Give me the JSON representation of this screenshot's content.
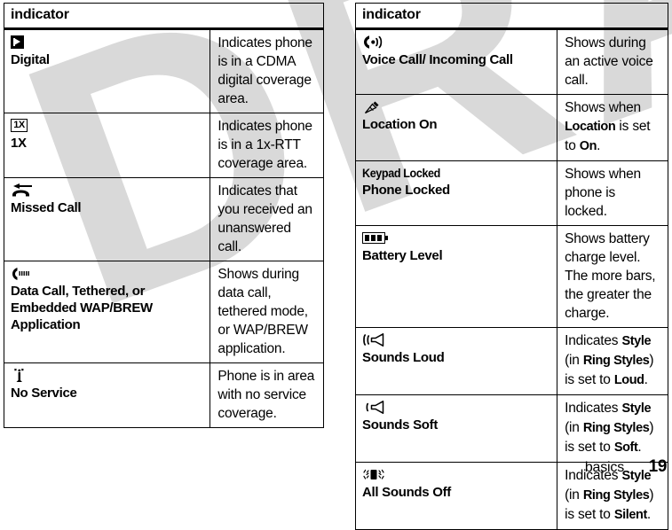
{
  "document": {
    "watermark": "DRAFT",
    "footer": {
      "section": "basics",
      "page_number": "19"
    }
  },
  "tables": {
    "left": {
      "header": "indicator",
      "rows": [
        {
          "icon": "digital-square-icon",
          "name": "Digital",
          "description": "Indicates phone is in a CDMA digital coverage area."
        },
        {
          "icon": "1x-box-icon",
          "icon_text": "1X",
          "name": "1X",
          "description": "Indicates phone is in a 1x-RTT coverage area."
        },
        {
          "icon": "missed-call-icon",
          "name": "Missed Call",
          "description": "Indicates that you received an unanswered call."
        },
        {
          "icon": "data-call-icon",
          "name": "Data Call, Tethered, or Embedded WAP/BREW Application",
          "description": "Shows during data call, tethered mode, or WAP/BREW application."
        },
        {
          "icon": "no-service-antenna-icon",
          "name": "No Service",
          "description": "Phone is in area with no service coverage."
        }
      ]
    },
    "right": {
      "header": "indicator",
      "rows": [
        {
          "icon": "voice-call-icon",
          "name": "Voice Call/ Incoming Call",
          "description": "Shows during an active voice call."
        },
        {
          "icon": "location-on-icon",
          "name": "Location On",
          "description_parts": [
            {
              "text": "Shows when ",
              "bold": false
            },
            {
              "text": "Location",
              "bold": true
            },
            {
              "text": " is set to ",
              "bold": false
            },
            {
              "text": "On",
              "bold": true
            },
            {
              "text": ".",
              "bold": false
            }
          ]
        },
        {
          "icon": "keypad-locked-text-icon",
          "icon_text": "Keypad Locked",
          "name": "Phone Locked",
          "description": "Shows when phone is locked."
        },
        {
          "icon": "battery-level-icon",
          "name": "Battery Level",
          "description": "Shows battery charge level. The more bars, the greater the charge."
        },
        {
          "icon": "sounds-loud-speaker-icon",
          "name": "Sounds Loud",
          "description_parts": [
            {
              "text": "Indicates ",
              "bold": false
            },
            {
              "text": "Style",
              "bold": true
            },
            {
              "text": " (in ",
              "bold": false
            },
            {
              "text": "Ring Styles",
              "bold": true
            },
            {
              "text": ") is set to ",
              "bold": false
            },
            {
              "text": "Loud",
              "bold": true
            },
            {
              "text": ".",
              "bold": false
            }
          ]
        },
        {
          "icon": "sounds-soft-speaker-icon",
          "name": "Sounds Soft",
          "description_parts": [
            {
              "text": "Indicates ",
              "bold": false
            },
            {
              "text": "Style",
              "bold": true
            },
            {
              "text": " (in ",
              "bold": false
            },
            {
              "text": "Ring Styles",
              "bold": true
            },
            {
              "text": ") is set to ",
              "bold": false
            },
            {
              "text": "Soft",
              "bold": true
            },
            {
              "text": ".",
              "bold": false
            }
          ]
        },
        {
          "icon": "all-sounds-off-vibrate-icon",
          "name": "All Sounds Off",
          "description_parts": [
            {
              "text": "Indicates ",
              "bold": false
            },
            {
              "text": "Style",
              "bold": true
            },
            {
              "text": " (in ",
              "bold": false
            },
            {
              "text": "Ring Styles",
              "bold": true
            },
            {
              "text": ") is set to ",
              "bold": false
            },
            {
              "text": "Silent",
              "bold": true
            },
            {
              "text": ".",
              "bold": false
            }
          ]
        }
      ]
    }
  }
}
